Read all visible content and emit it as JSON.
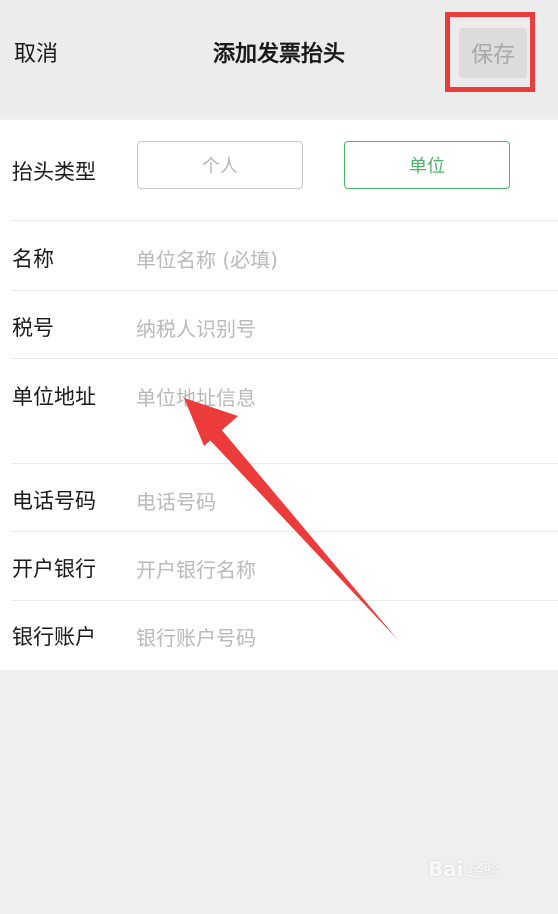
{
  "nav": {
    "cancel": "取消",
    "title": "添加发票抬头",
    "save": "保存"
  },
  "form": {
    "type_label": "抬头类型",
    "type_options": [
      "个人",
      "单位"
    ],
    "selected_type": "单位",
    "fields": [
      {
        "label": "名称",
        "placeholder": "单位名称 (必填)"
      },
      {
        "label": "税号",
        "placeholder": "纳税人识别号"
      },
      {
        "label": "单位地址",
        "placeholder": "单位地址信息"
      },
      {
        "label": "电话号码",
        "placeholder": "电话号码"
      },
      {
        "label": "开户银行",
        "placeholder": "开户银行名称"
      },
      {
        "label": "银行账户",
        "placeholder": "银行账户号码"
      }
    ]
  },
  "colors": {
    "accent_green": "#4cb56b",
    "highlight_red": "#ec3b3b"
  },
  "watermark": {
    "brand": "Bai",
    "sub": "经验"
  }
}
